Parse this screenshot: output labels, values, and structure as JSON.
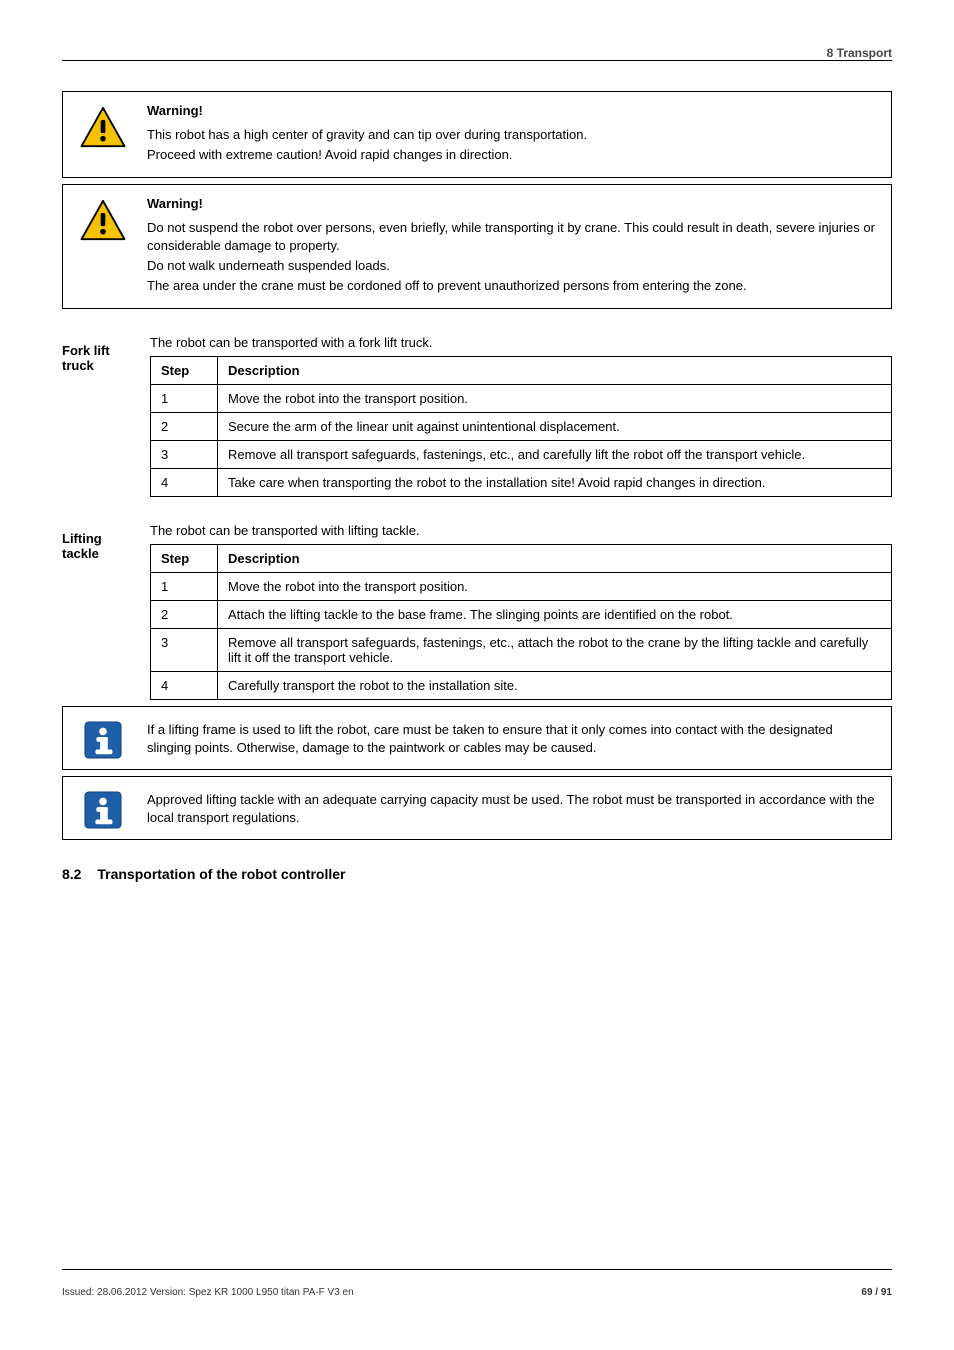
{
  "header_right": "8 Transport",
  "warning1": {
    "heading": "Warning!",
    "lines": [
      "This robot has a high center of gravity and can tip over during transportation.",
      "Proceed with extreme caution! Avoid rapid changes in direction."
    ]
  },
  "warning2": {
    "heading": "Warning!",
    "lines": [
      "Do not suspend the robot over persons, even briefly, while transporting it by crane. This could result in death, severe injuries or considerable damage to property.",
      "Do not walk underneath suspended loads.",
      "The area under the crane must be cordoned off to prevent unauthorized persons from entering the zone."
    ]
  },
  "fork": {
    "label": "Fork lift truck",
    "intro": "The robot can be transported with a fork lift truck.",
    "headers": {
      "step": "Step",
      "desc": "Description"
    },
    "rows": [
      {
        "step": "1",
        "desc": "Move the robot into the transport position."
      },
      {
        "step": "2",
        "desc": "Secure the arm of the linear unit against unintentional displacement."
      },
      {
        "step": "3",
        "desc": "Remove all transport safeguards, fastenings, etc., and carefully lift the robot off the transport vehicle."
      },
      {
        "step": "4",
        "desc": "Take care when transporting the robot to the installation site! Avoid rapid changes in direction."
      }
    ]
  },
  "lift": {
    "label": "Lifting tackle",
    "intro": "The robot can be transported with lifting tackle.",
    "headers": {
      "step": "Step",
      "desc": "Description"
    },
    "rows": [
      {
        "step": "1",
        "desc": "Move the robot into the transport position."
      },
      {
        "step": "2",
        "desc": "Attach the lifting tackle to the base frame. The slinging points are identified on the robot."
      },
      {
        "step": "3",
        "desc": "Remove all transport safeguards, fastenings, etc., attach the robot to the crane by the lifting tackle and carefully lift it off the transport vehicle."
      },
      {
        "step": "4",
        "desc": "Carefully transport the robot to the installation site."
      }
    ]
  },
  "info1": "If a lifting frame is used to lift the robot, care must be taken to ensure that it only comes into contact with the designated slinging points. Otherwise, damage to the paintwork or cables may be caused.",
  "info2": "Approved lifting tackle with an adequate carrying capacity must be used. The robot must be transported in accordance with the local transport regulations.",
  "section": {
    "number": "8.2",
    "title": "Transportation of the robot controller"
  },
  "footer": {
    "left": "Issued: 28.06.2012 Version: Spez KR 1000 L950 titan PA-F V3 en",
    "right": "69 / 91"
  }
}
